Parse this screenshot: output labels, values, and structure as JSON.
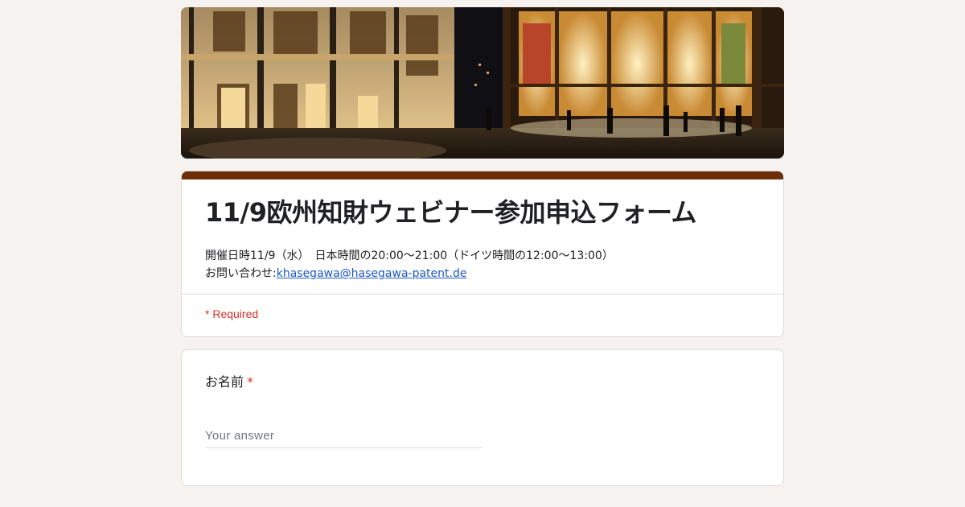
{
  "form": {
    "title": "11/9欧州知財ウェビナー参加申込フォーム",
    "description": {
      "line1": "開催日時11/9（水）　日本時間の20:00～21:00（ドイツ時間の12:00～13:00）",
      "contact_prefix": "お問い合わせ:",
      "contact_email": "khasegawa@hasegawa-patent.de"
    },
    "required_note": "* Required",
    "theme_color": "#6b2e07"
  },
  "questions": [
    {
      "label": "お名前",
      "required_mark": "*",
      "placeholder": "Your answer"
    }
  ]
}
